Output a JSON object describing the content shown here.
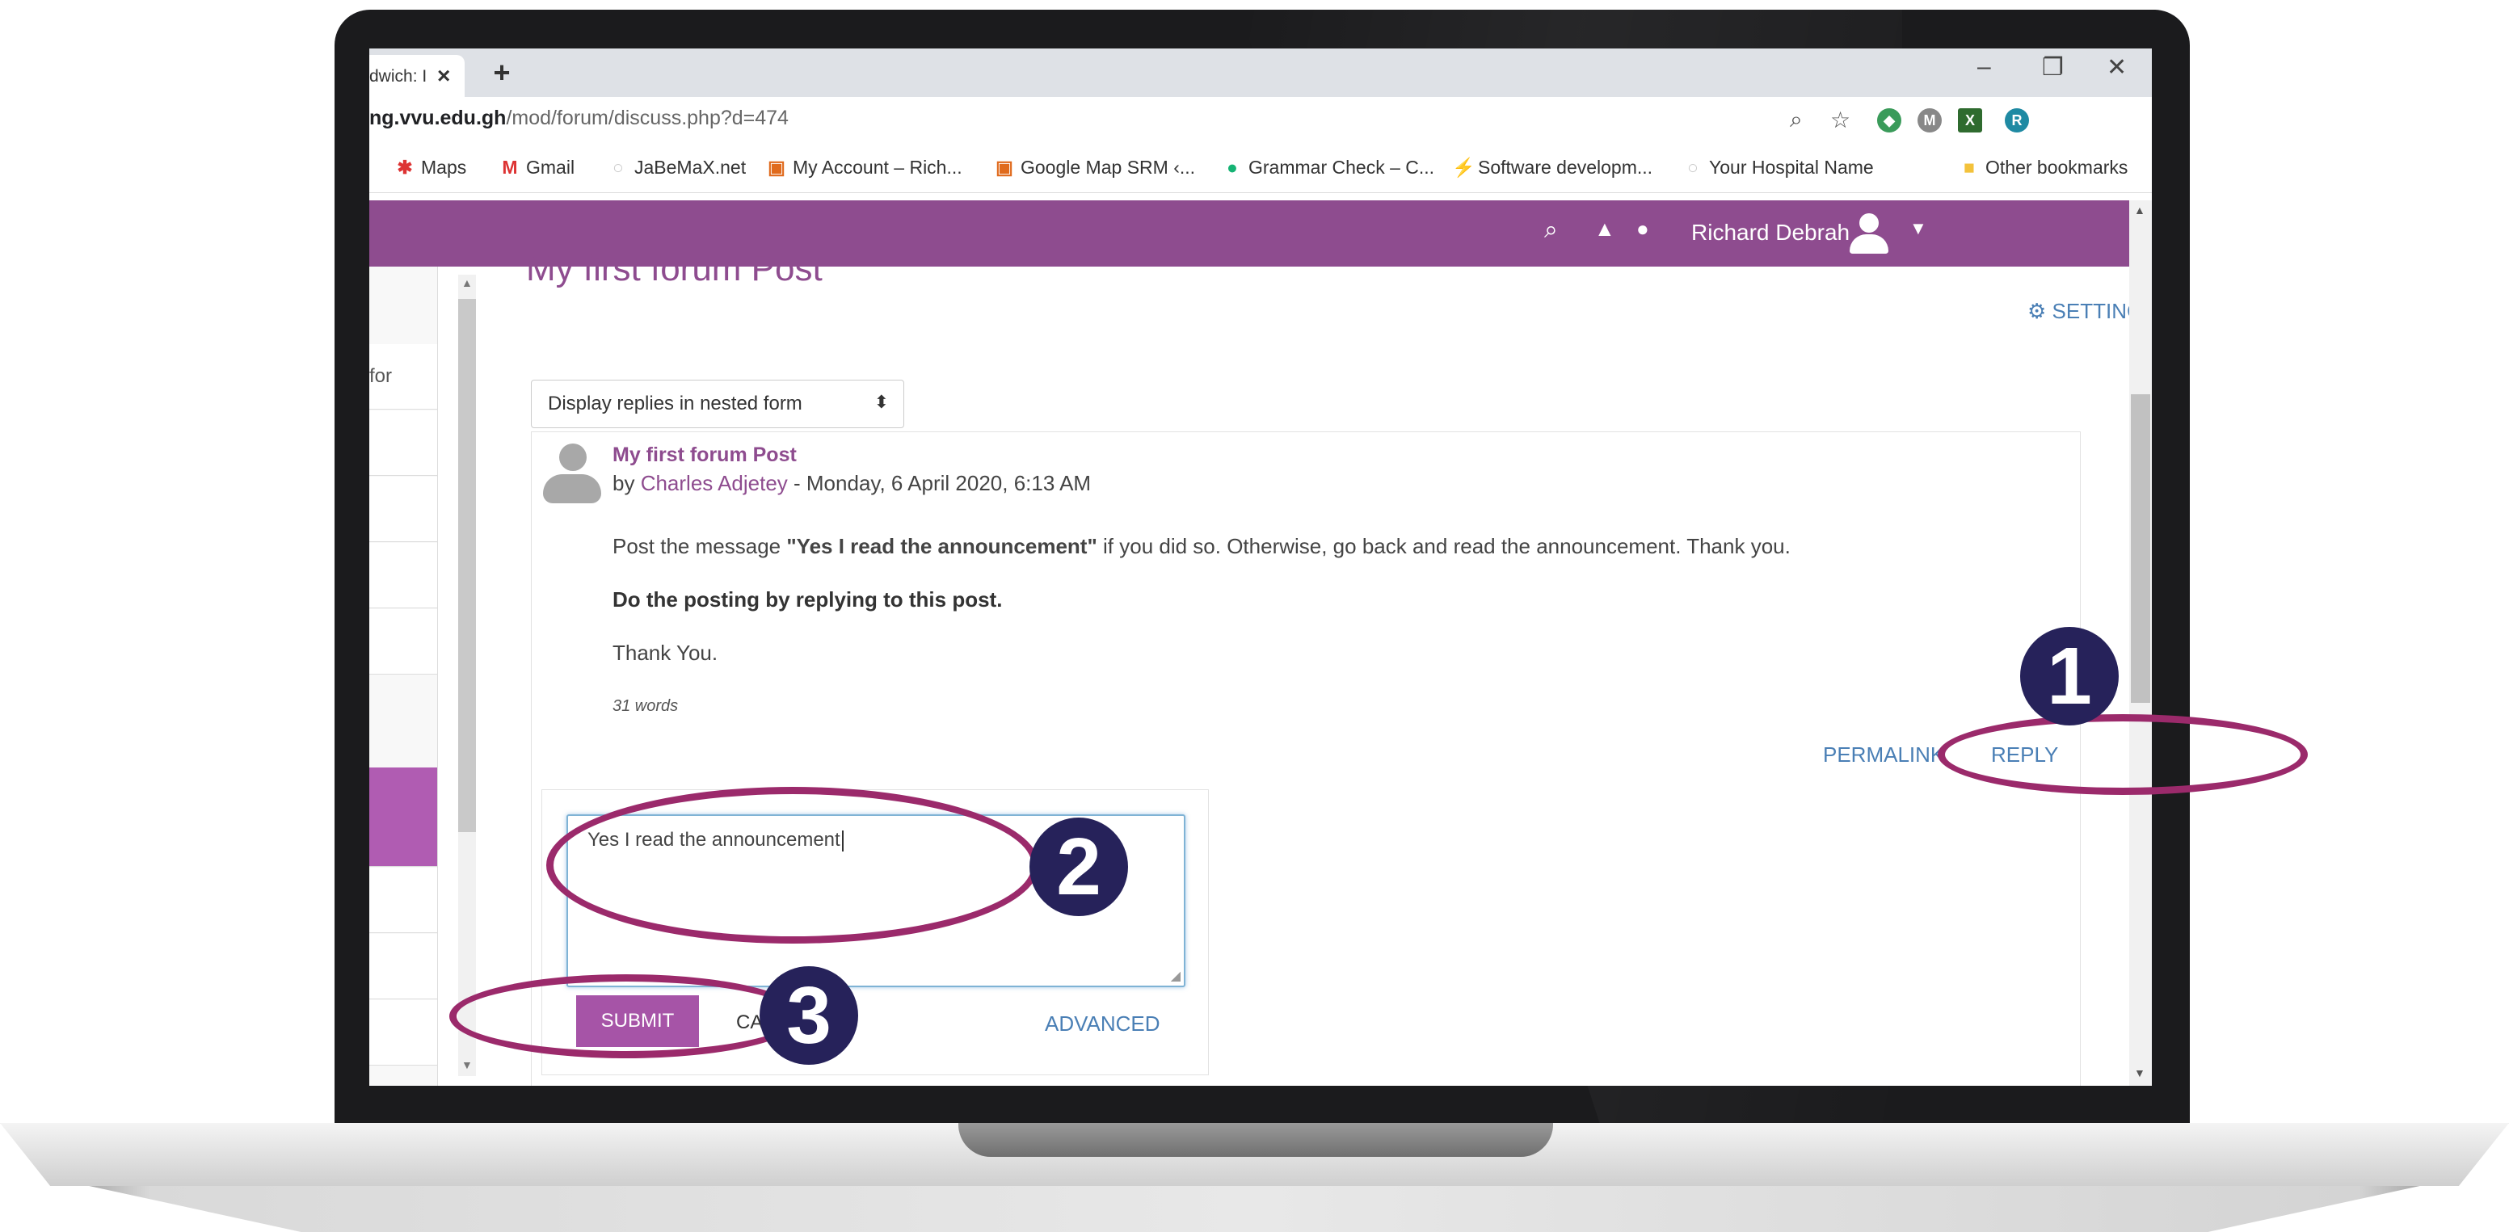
{
  "browser": {
    "tab_title": "dwich: I",
    "tab_close": "×",
    "new_tab": "+",
    "window_controls": [
      "–",
      "❐",
      "✕"
    ],
    "url_host": "ng.vvu.edu.gh",
    "url_path": "/mod/forum/discuss.php?d=474",
    "profile_initial": "R",
    "bookmarks": [
      {
        "label": "Maps",
        "icon": "maps-icon"
      },
      {
        "label": "Gmail",
        "icon": "gmail-icon"
      },
      {
        "label": "JaBeMaX.net",
        "icon": "globe-icon"
      },
      {
        "label": "My Account – Rich...",
        "icon": "bookmark-icon"
      },
      {
        "label": "Google Map SRM ‹...",
        "icon": "bookmark-icon"
      },
      {
        "label": "Grammar Check – C...",
        "icon": "grammarly-icon"
      },
      {
        "label": "Software developm...",
        "icon": "bolt-icon"
      },
      {
        "label": "Your Hospital Name",
        "icon": "globe-icon"
      },
      {
        "label": "Other bookmarks",
        "icon": "folder-icon"
      }
    ]
  },
  "navbar": {
    "user_name": "Richard Debrah",
    "background": "#8e4c8f"
  },
  "drawer": {
    "fragment": "for"
  },
  "main": {
    "page_title": "My first forum Post",
    "settings_label": "SETTINGS",
    "display_mode": "Display replies in nested form",
    "post": {
      "subject": "My first forum Post",
      "by": "by ",
      "author": "Charles Adjetey",
      "date": " - Monday, 6 April 2020, 6:13 AM",
      "p1_before": "Post the message ",
      "p1_bold": "\"Yes I read the announcement\"",
      "p1_after": " if you did so. Otherwise, go back and read the announcement. Thank you.",
      "p2": "Do the posting by replying to this post.",
      "p3": "Thank You.",
      "word_count": "31 words",
      "permalink": "PERMALINK",
      "reply": "REPLY"
    },
    "reply_form": {
      "text": "Yes I read the announcement",
      "submit": "SUBMIT",
      "cancel": "CA",
      "advanced": "ADVANCED"
    }
  },
  "annotations": {
    "steps": [
      "1",
      "2",
      "3"
    ],
    "ring_color": "#9b2a6b",
    "badge_color": "#26225a"
  }
}
